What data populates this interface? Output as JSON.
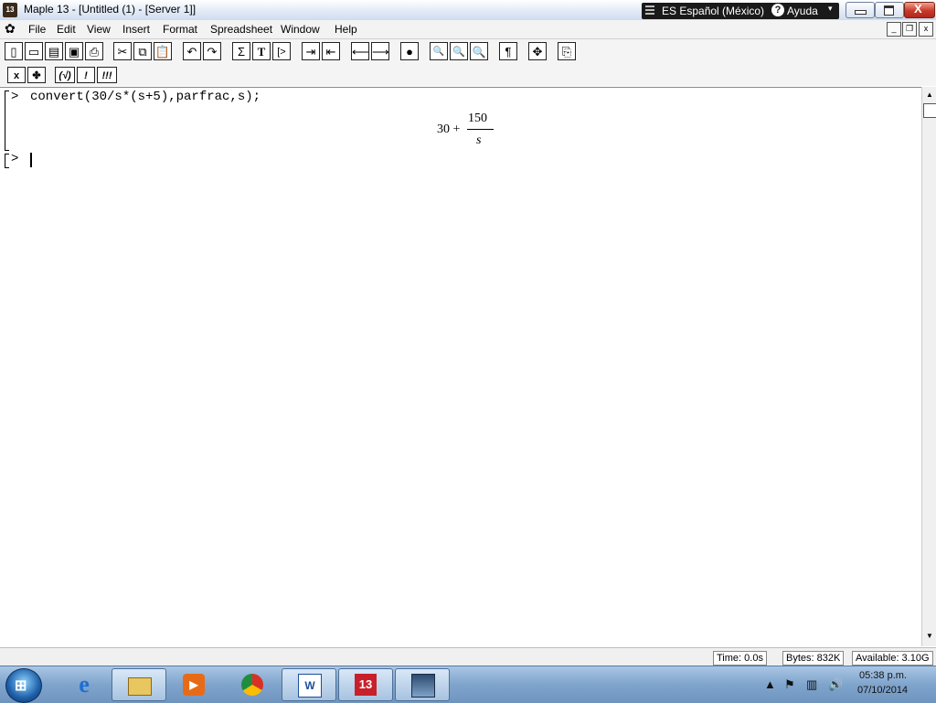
{
  "window": {
    "title": "Maple 13  - [Untitled (1) - [Server 1]]",
    "app_icon": "maple-leaf-icon",
    "language_bar": {
      "language": "ES Español (México)",
      "help_label": "Ayuda",
      "help_glyph": "?"
    },
    "controls": {
      "minimize": "minimize",
      "maximize": "maximize",
      "close": "X"
    }
  },
  "menubar": {
    "items": [
      "File",
      "Edit",
      "View",
      "Insert",
      "Format",
      "Spreadsheet",
      "Window",
      "Help"
    ],
    "mdi": {
      "minimize": "_",
      "restore": "❐",
      "close": "x"
    }
  },
  "toolbar1": {
    "icons": [
      "new-document-icon",
      "open-folder-icon",
      "open-url-icon",
      "save-icon",
      "print-icon",
      "cut-icon",
      "copy-icon",
      "paste-icon",
      "undo-icon",
      "redo-icon",
      "sigma-icon",
      "text-icon",
      "execution-group-icon",
      "indent-icon",
      "outdent-icon",
      "back-arrow-icon",
      "forward-arrow-icon",
      "stop-icon",
      "zoom-100-icon",
      "zoom-150-icon",
      "zoom-200-icon",
      "paragraph-icon",
      "expand-icon",
      "restart-icon"
    ],
    "glyphs": {
      "sigma": "Σ",
      "text": "T",
      "group": "[>",
      "paragraph": "¶",
      "back": "⟵",
      "forward": "⟶",
      "stop": "●"
    }
  },
  "toolbar2": {
    "buttons": [
      {
        "name": "math-mode-button",
        "glyph": "x"
      },
      {
        "name": "maple-leaf-button",
        "glyph": "✤"
      },
      {
        "name": "check-syntax-button",
        "glyph": "(√)"
      },
      {
        "name": "execute-button",
        "glyph": "!"
      },
      {
        "name": "execute-all-button",
        "glyph": "!!!"
      }
    ]
  },
  "worksheet": {
    "prompt": ">",
    "input": "convert(30/s*(s+5),parfrac,s);",
    "output": {
      "left": "30 +",
      "numerator": "150",
      "denominator": "s"
    },
    "prompt2": ">"
  },
  "statusbar": {
    "time": "Time:  0.0s",
    "bytes": "Bytes:  832K",
    "available": "Available:  3.10G"
  },
  "taskbar": {
    "apps": [
      "internet-explorer-icon",
      "file-explorer-icon",
      "media-player-icon",
      "chrome-icon",
      "word-icon",
      "maple-13-icon",
      "screenshot-icon"
    ],
    "labels": {
      "ie": "e",
      "word": "W",
      "maple": "13"
    },
    "clock": {
      "time": "05:38 p.m.",
      "date": "07/10/2014"
    }
  }
}
